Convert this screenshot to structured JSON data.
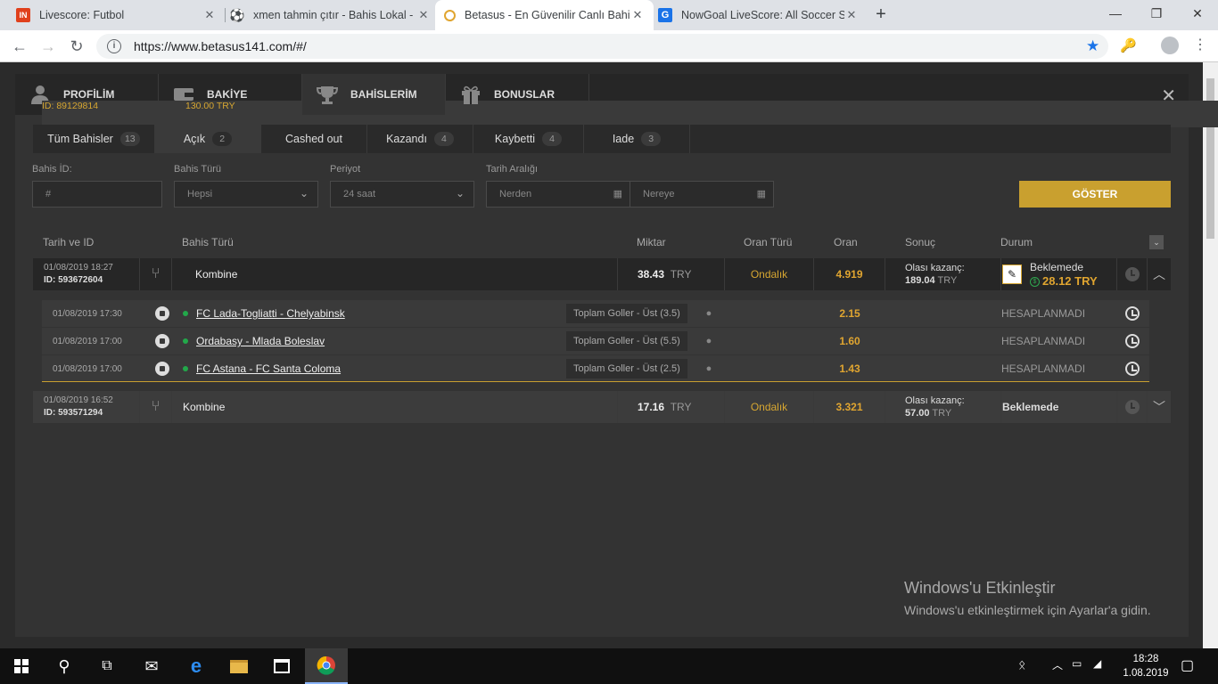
{
  "browser": {
    "tabs": [
      {
        "title": "Livescore: Futbol",
        "favicon": "livescore-icon"
      },
      {
        "title": "xmen tahmin çıtır - Bahis Lokal -",
        "favicon": "soccer-ball-icon"
      },
      {
        "title": "Betasus - En Güvenilir Canlı Bahis",
        "favicon": "betasus-icon"
      },
      {
        "title": "NowGoal LiveScore: All Soccer Sc",
        "favicon": "nowgoal-icon"
      }
    ],
    "url": "https://www.betasus141.com/#/"
  },
  "modal": {
    "tabs": {
      "profile": {
        "label": "PROFİLİM",
        "sub": "ID: 89129814"
      },
      "balance": {
        "label": "BAKİYE",
        "sub": "130.00 TRY"
      },
      "bets": {
        "label": "BAHİSLERİM"
      },
      "bonus": {
        "label": "BONUSLAR"
      }
    },
    "filter_tabs": [
      {
        "label": "Tüm Bahisler",
        "count": "13"
      },
      {
        "label": "Açık",
        "count": "2"
      },
      {
        "label": "Cashed out",
        "count": ""
      },
      {
        "label": "Kazandı",
        "count": "4"
      },
      {
        "label": "Kaybetti",
        "count": "4"
      },
      {
        "label": "Iade",
        "count": "3"
      }
    ],
    "filters": {
      "bet_id": {
        "label": "Bahis İD:",
        "placeholder": "#"
      },
      "bet_type": {
        "label": "Bahis Türü",
        "value": "Hepsi"
      },
      "period": {
        "label": "Periyot",
        "value": "24 saat"
      },
      "date_range": {
        "label": "Tarih Aralığı",
        "from": "Nerden",
        "to": "Nereye"
      },
      "submit": "GÖSTER"
    },
    "table": {
      "headers": {
        "date_id": "Tarih ve ID",
        "bet_type": "Bahis Türü",
        "amount": "Miktar",
        "odds_type": "Oran Türü",
        "odds": "Oran",
        "result": "Sonuç",
        "status": "Durum"
      },
      "bets": [
        {
          "date": "01/08/2019 18:27",
          "id": "ID: 593672604",
          "type": "Kombine",
          "amount": "38.43",
          "currency": "TRY",
          "odds_type": "Ondalık",
          "odds": "4.919",
          "result_label": "Olası kazanç:",
          "result_value": "189.04",
          "result_currency": "TRY",
          "status": "Beklemede",
          "cashout": "28.12 TRY",
          "events": [
            {
              "date": "01/08/2019 17:30",
              "match": "FC Lada-Togliatti - Chelyabinsk",
              "market": "Toplam Goller - Üst (3.5)",
              "odds": "2.15",
              "status": "HESAPLANMADI"
            },
            {
              "date": "01/08/2019 17:00",
              "match": "Ordabasy - Mlada Boleslav",
              "market": "Toplam Goller - Üst (5.5)",
              "odds": "1.60",
              "status": "HESAPLANMADI"
            },
            {
              "date": "01/08/2019 17:00",
              "match": "FC Astana - FC Santa Coloma",
              "market": "Toplam Goller - Üst (2.5)",
              "odds": "1.43",
              "status": "HESAPLANMADI"
            }
          ]
        },
        {
          "date": "01/08/2019 16:52",
          "id": "ID: 593571294",
          "type": "Kombine",
          "amount": "17.16",
          "currency": "TRY",
          "odds_type": "Ondalık",
          "odds": "3.321",
          "result_label": "Olası kazanç:",
          "result_value": "57.00",
          "result_currency": "TRY",
          "status": "Beklemede"
        }
      ]
    }
  },
  "watermark": {
    "title": "Windows'u Etkinleştir",
    "text": "Windows'u etkinleştirmek için Ayarlar'a gidin."
  },
  "taskbar": {
    "time": "18:28",
    "date": "1.08.2019"
  },
  "colors": {
    "accent": "#c9a02f",
    "odds": "#e0a530",
    "live_dot": "#22a84a"
  }
}
